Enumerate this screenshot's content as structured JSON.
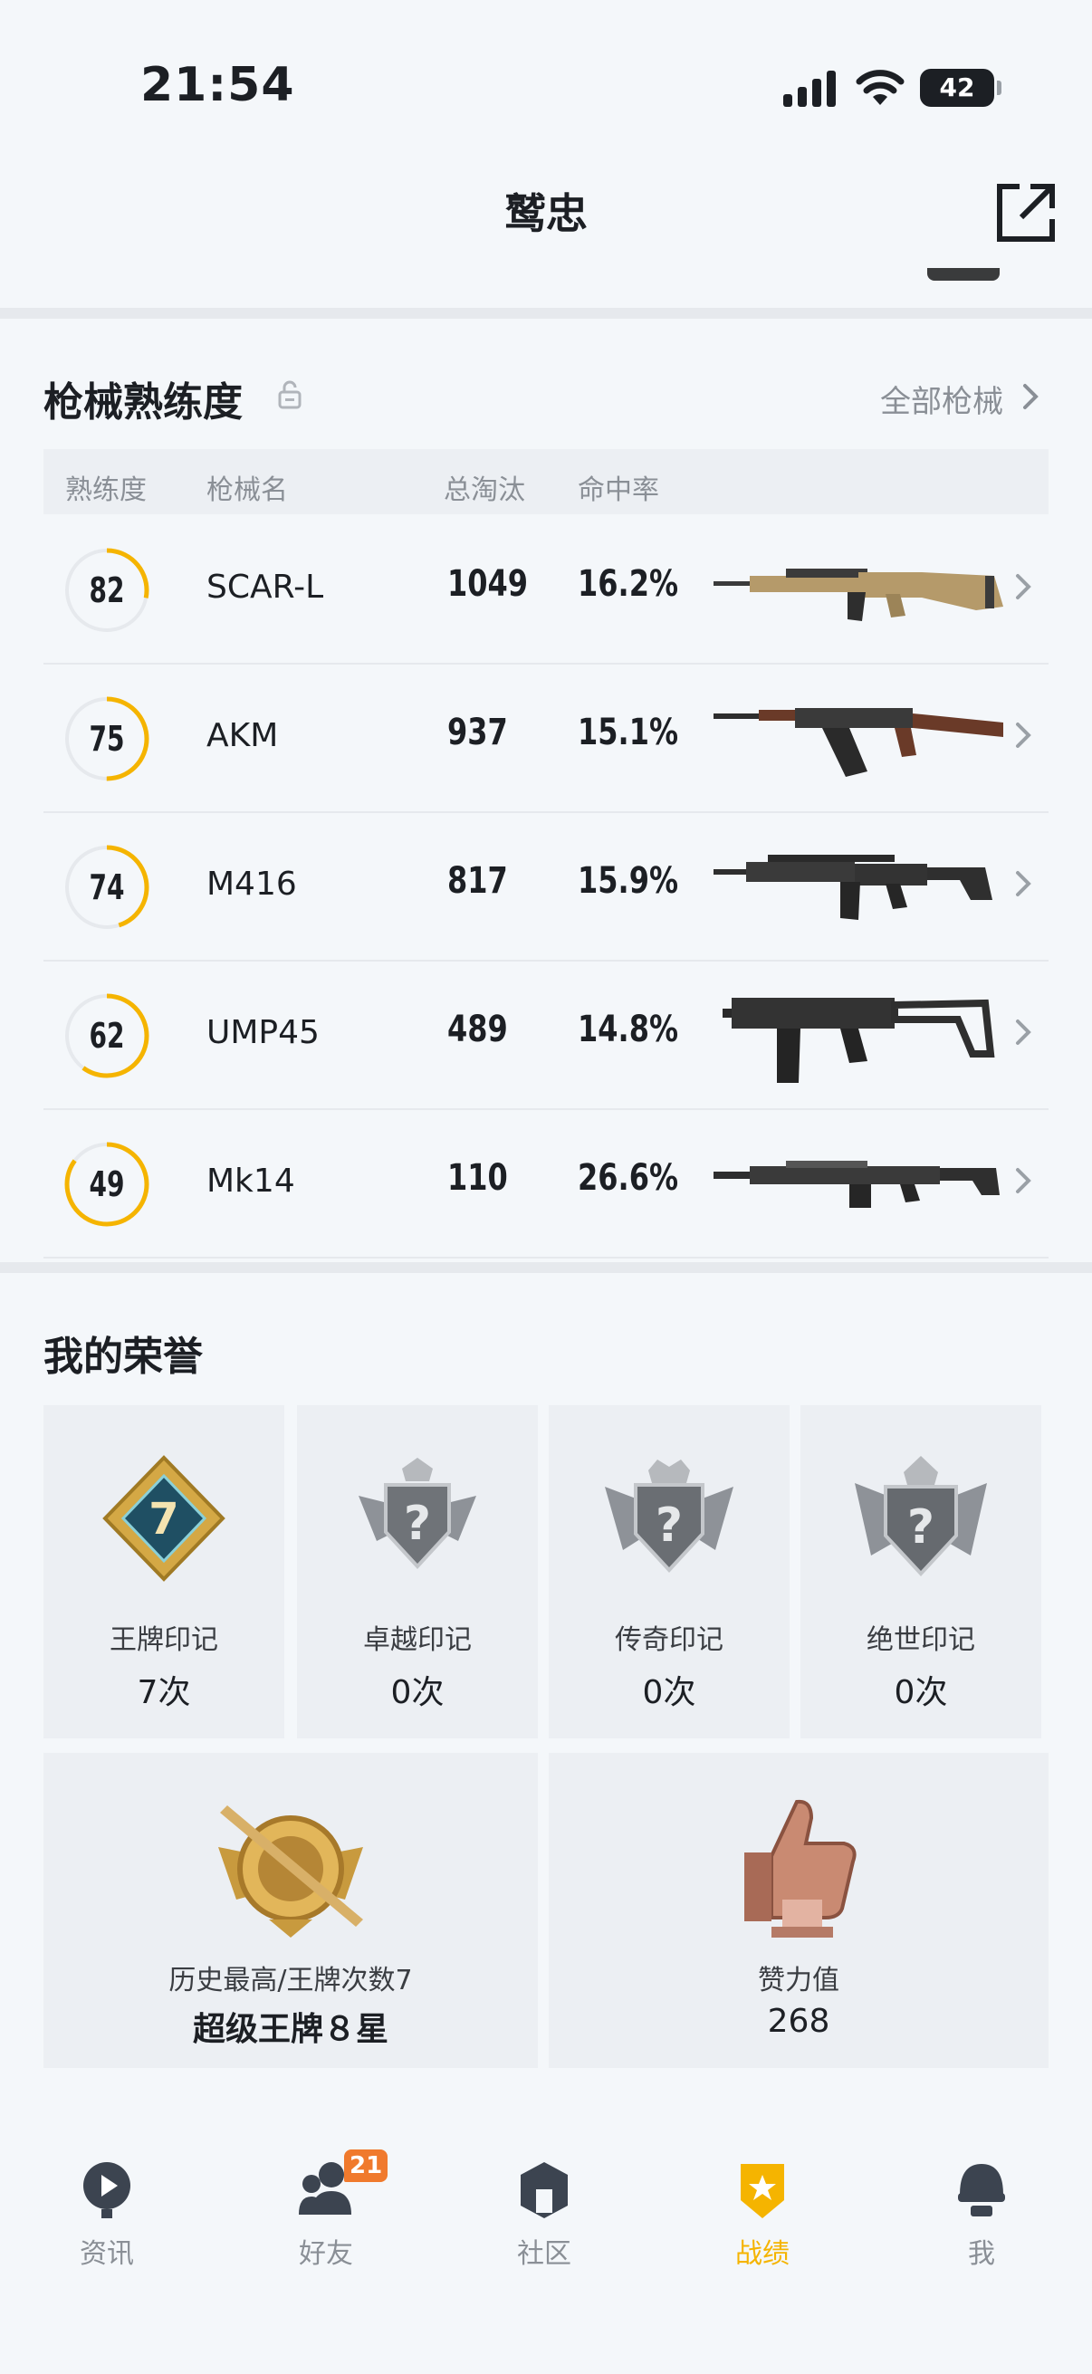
{
  "status_bar": {
    "time": "21:54",
    "battery": "42"
  },
  "header": {
    "title": "鹫忠"
  },
  "weapon_section": {
    "title": "枪械熟练度",
    "all_link": "全部枪械",
    "columns": {
      "proficiency": "熟练度",
      "name": "枪械名",
      "kills": "总淘汰",
      "accuracy": "命中率"
    },
    "rows": [
      {
        "level": "82",
        "progress": 0.28,
        "name": "SCAR-L",
        "kills": "1049",
        "accuracy": "16.2%",
        "icon": "scar-l-rifle"
      },
      {
        "level": "75",
        "progress": 0.5,
        "name": "AKM",
        "kills": "937",
        "accuracy": "15.1%",
        "icon": "akm-rifle"
      },
      {
        "level": "74",
        "progress": 0.45,
        "name": "M416",
        "kills": "817",
        "accuracy": "15.9%",
        "icon": "m416-rifle"
      },
      {
        "level": "62",
        "progress": 0.6,
        "name": "UMP45",
        "kills": "489",
        "accuracy": "14.8%",
        "icon": "ump45-smg"
      },
      {
        "level": "49",
        "progress": 0.85,
        "name": "Mk14",
        "kills": "110",
        "accuracy": "26.6%",
        "icon": "mk14-dmr"
      }
    ],
    "accent_color": "#f5b400"
  },
  "honor_section": {
    "title": "我的荣誉",
    "marks": [
      {
        "label": "王牌印记",
        "count": "7次",
        "icon": "ace-mark-badge",
        "badge_text": "7"
      },
      {
        "label": "卓越印记",
        "count": "0次",
        "icon": "excellence-mark-badge",
        "badge_text": "?"
      },
      {
        "label": "传奇印记",
        "count": "0次",
        "icon": "legend-mark-badge",
        "badge_text": "?"
      },
      {
        "label": "绝世印记",
        "count": "0次",
        "icon": "peerless-mark-badge",
        "badge_text": "?"
      }
    ],
    "history": {
      "label": "历史最高/王牌次数7",
      "value": "超级王牌８星",
      "icon": "ace-rank-badge"
    },
    "likes": {
      "label": "赞力值",
      "value": "268",
      "icon": "thumbs-up-trophy"
    }
  },
  "tab_bar": {
    "tabs": [
      {
        "label": "资讯",
        "icon": "news-icon",
        "active": false
      },
      {
        "label": "好友",
        "icon": "friends-icon",
        "active": false,
        "badge": "21"
      },
      {
        "label": "社区",
        "icon": "community-icon",
        "active": false
      },
      {
        "label": "战绩",
        "icon": "record-icon",
        "active": true
      },
      {
        "label": "我",
        "icon": "profile-helmet-icon",
        "active": false
      }
    ],
    "active_color": "#f5b400",
    "badge_color": "#f07a2d"
  }
}
